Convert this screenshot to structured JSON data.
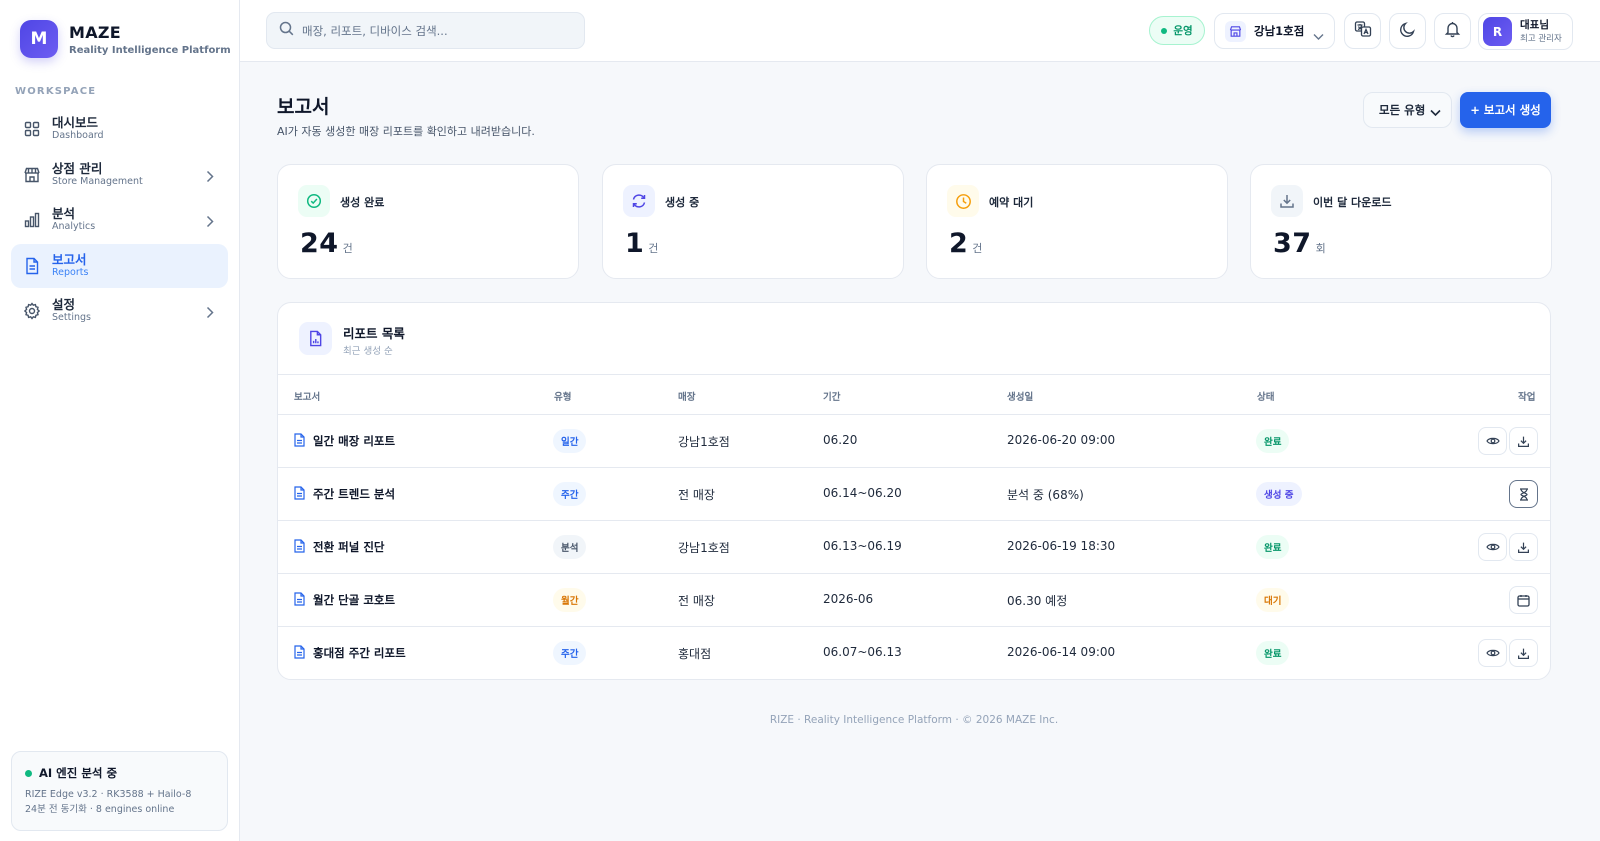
{
  "brand": {
    "logo_letter": "M",
    "name": "MAZE",
    "tagline": "Reality Intelligence Platform"
  },
  "sidebar": {
    "section_label": "WORKSPACE",
    "items": [
      {
        "title": "대시보드",
        "sub": "Dashboard",
        "icon": "grid-icon",
        "active": false,
        "has_chevron": false
      },
      {
        "title": "상점 관리",
        "sub": "Store Management",
        "icon": "store-icon",
        "active": false,
        "has_chevron": true
      },
      {
        "title": "분석",
        "sub": "Analytics",
        "icon": "bar-chart-icon",
        "active": false,
        "has_chevron": true
      },
      {
        "title": "보고서",
        "sub": "Reports",
        "icon": "document-icon",
        "active": true,
        "has_chevron": false
      },
      {
        "title": "설정",
        "sub": "Settings",
        "icon": "gear-icon",
        "active": false,
        "has_chevron": true
      }
    ],
    "ai_status": {
      "title": "AI 엔진 분석 중",
      "line1": "RIZE Edge v3.2 · RK3588 + Hailo-8",
      "line2": "24분 전 동기화 · 8 engines online"
    }
  },
  "topbar": {
    "search_placeholder": "매장, 리포트, 디바이스 검색...",
    "status_label": "운영",
    "store_name": "강남1호점",
    "user": {
      "avatar_letter": "R",
      "name": "대표님",
      "role": "최고 관리자"
    }
  },
  "page": {
    "title": "보고서",
    "description": "AI가 자동 생성한 매장 리포트를 확인하고 내려받습니다.",
    "type_filter": "모든 유형",
    "create_button": "+ 보고서 생성"
  },
  "stats": [
    {
      "label": "생성 완료",
      "value": "24",
      "unit": "건",
      "icon": "check-circle-icon",
      "color": "#10b981"
    },
    {
      "label": "생성 중",
      "value": "1",
      "unit": "건",
      "icon": "refresh-icon",
      "color": "#4f46e5"
    },
    {
      "label": "예약 대기",
      "value": "2",
      "unit": "건",
      "icon": "clock-icon",
      "color": "#f59e0b"
    },
    {
      "label": "이번 달 다운로드",
      "value": "37",
      "unit": "회",
      "icon": "download-icon",
      "color": "#64748b"
    }
  ],
  "report_list": {
    "title": "리포트 목록",
    "subtitle": "최근 생성 순",
    "columns": {
      "report": "보고서",
      "type": "유형",
      "store": "매장",
      "period": "기간",
      "created": "생성일",
      "status": "상태",
      "action": "작업"
    },
    "rows": [
      {
        "name": "일간 매장 리포트",
        "type": "일간",
        "store": "강남1호점",
        "period": "06.20",
        "created": "2026-06-20 09:00",
        "status": "완료",
        "actions": [
          "view",
          "download"
        ]
      },
      {
        "name": "주간 트렌드 분석",
        "type": "주간",
        "store": "전 매장",
        "period": "06.14~06.20",
        "created": "분석 중 (68%)",
        "status": "생성 중",
        "actions": [
          "hourglass"
        ]
      },
      {
        "name": "전환 퍼널 진단",
        "type": "분석",
        "store": "강남1호점",
        "period": "06.13~06.19",
        "created": "2026-06-19 18:30",
        "status": "완료",
        "actions": [
          "view",
          "download"
        ]
      },
      {
        "name": "월간 단골 코호트",
        "type": "월간",
        "store": "전 매장",
        "period": "2026-06",
        "created": "06.30 예정",
        "status": "대기",
        "actions": [
          "calendar"
        ]
      },
      {
        "name": "홍대점 주간 리포트",
        "type": "주간",
        "store": "홍대점",
        "period": "06.07~06.13",
        "created": "2026-06-14 09:00",
        "status": "완료",
        "actions": [
          "view",
          "download"
        ]
      }
    ]
  },
  "footer": "RIZE · Reality Intelligence Platform · © 2026 MAZE Inc."
}
